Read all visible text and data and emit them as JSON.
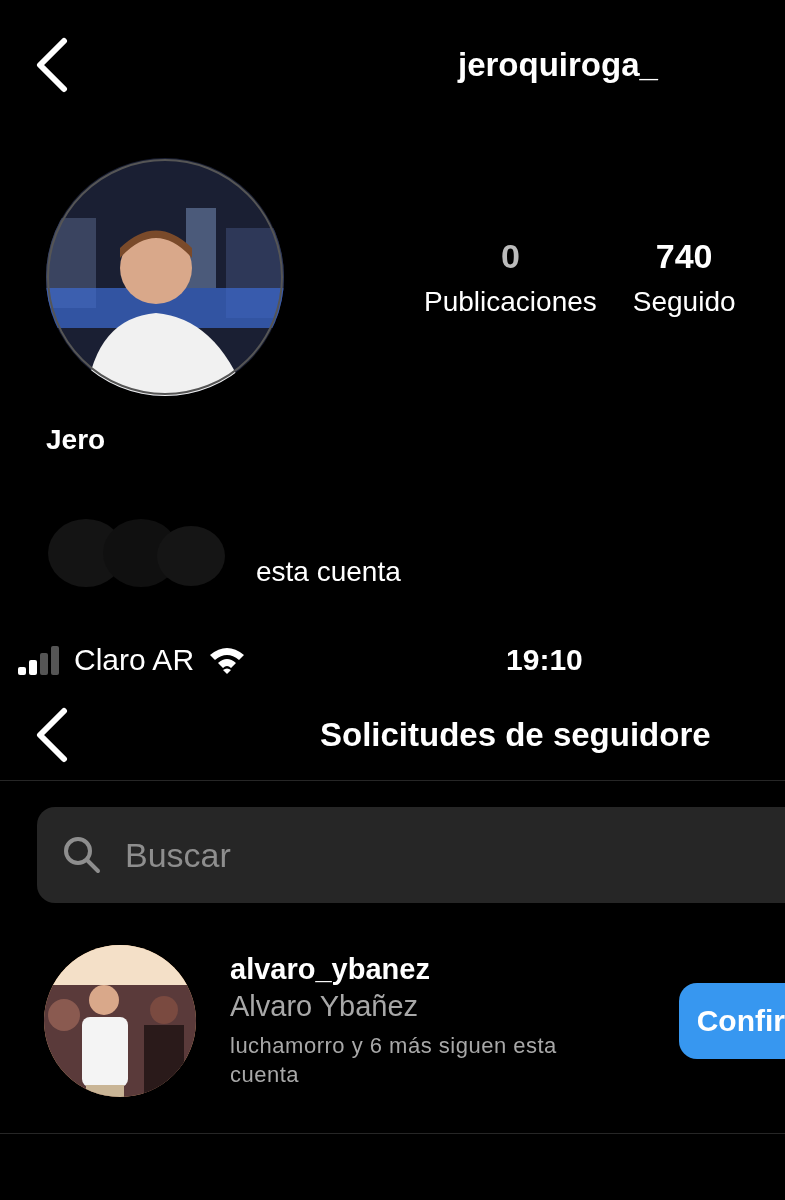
{
  "profile_screen": {
    "username": "jeroquiroga_",
    "name": "Jero",
    "stats": [
      {
        "value": "0",
        "label": "Publicaciones"
      },
      {
        "value": "740",
        "label": "Seguido"
      }
    ],
    "followed_by": "esta cuenta"
  },
  "status_bar": {
    "carrier": "Claro AR",
    "time": "19:10"
  },
  "requests_screen": {
    "title": "Solicitudes de seguidore",
    "search": {
      "placeholder": "Buscar"
    },
    "requests": [
      {
        "username": "alvaro_ybanez",
        "name": "Alvaro Ybañez",
        "mutuals": "luchamorro y 6 más siguen esta cuenta",
        "button": "Confir"
      }
    ]
  }
}
